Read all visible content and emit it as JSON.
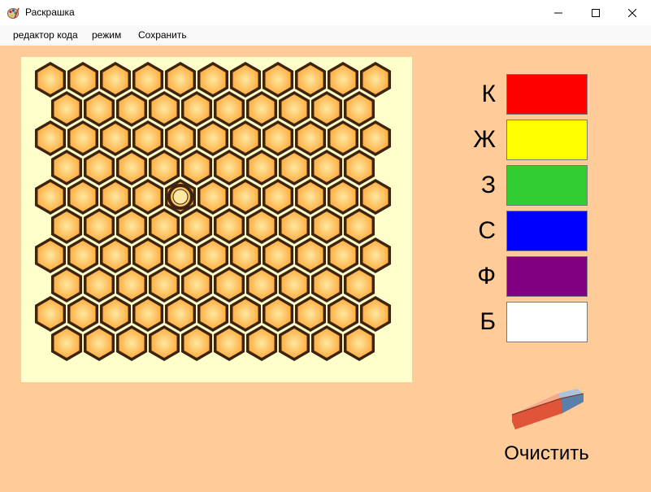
{
  "window": {
    "title": "Раскрашка",
    "icons": {
      "app": "paint-palette-icon",
      "minimize": "minimize-icon",
      "maximize": "maximize-icon",
      "close": "close-icon"
    }
  },
  "menu": {
    "items": [
      "редактор кода",
      "режим",
      "Сохранить"
    ]
  },
  "grid": {
    "rows": 10,
    "cols_even": 11,
    "cols_odd": 10,
    "cell_fill": "#ffa533",
    "cell_highlight": "#ffe8a0",
    "cell_stroke": "#3d2410",
    "cursor": {
      "row": 4,
      "col": 4
    }
  },
  "palette": {
    "colors": [
      {
        "label": "К",
        "color": "#ff0000"
      },
      {
        "label": "Ж",
        "color": "#ffff00"
      },
      {
        "label": "З",
        "color": "#33cc33"
      },
      {
        "label": "С",
        "color": "#0000ff"
      },
      {
        "label": "Ф",
        "color": "#800080"
      },
      {
        "label": "Б",
        "color": "#ffffff"
      }
    ]
  },
  "clear": {
    "label": "Очистить",
    "icon": "eraser-icon"
  },
  "theme": {
    "background": "#ffcc99",
    "canvas": "#ffffcc"
  }
}
